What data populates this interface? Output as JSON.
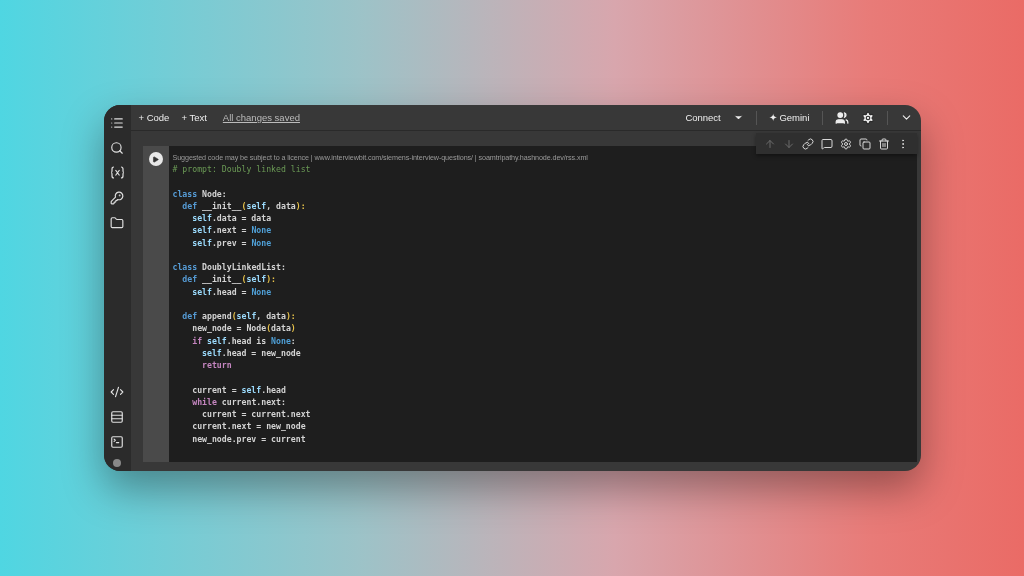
{
  "toolbar": {
    "actions": [
      "+ Code",
      "+ Text"
    ],
    "save_status": "All changes saved",
    "connect": "Connect",
    "gemini": "✦ Gemini"
  },
  "cell": {
    "notice": "Suggested code may be subject to a licence | www.interviewbit.com/siemens-interview-questions/ | soamtripathy.hashnode.dev/rss.xml",
    "cell_tools": [
      {
        "disabled": true
      },
      {
        "disabled": true
      },
      {
        "disabled": false
      },
      {
        "disabled": false
      },
      {
        "disabled": false
      },
      {
        "disabled": false
      },
      {
        "disabled": false
      },
      {
        "disabled": false
      }
    ],
    "lines": [
      {
        "kind": "code",
        "tokens": [
          {
            "t": "# prompt: Doubly linked list",
            "kind": "comment"
          }
        ]
      },
      {
        "kind": "blank"
      },
      {
        "kind": "code",
        "tokens": [
          {
            "t": "class",
            "kind": "keyword"
          },
          {
            "t": " Node:",
            "kind": "plain"
          }
        ]
      },
      {
        "kind": "code",
        "tokens": [
          {
            "t": "  def",
            "kind": "keyword"
          },
          {
            "t": " __init__",
            "kind": "plain"
          },
          {
            "t": "(",
            "kind": "paren"
          },
          {
            "t": "self",
            "kind": "self"
          },
          {
            "t": ", data",
            "kind": "plain"
          },
          {
            "t": "):",
            "kind": "paren"
          }
        ]
      },
      {
        "kind": "code",
        "tokens": [
          {
            "t": "    self",
            "kind": "self"
          },
          {
            "t": ".data = data",
            "kind": "plain"
          }
        ]
      },
      {
        "kind": "code",
        "tokens": [
          {
            "t": "    self",
            "kind": "self"
          },
          {
            "t": ".next = ",
            "kind": "plain"
          },
          {
            "t": "None",
            "kind": "const"
          }
        ]
      },
      {
        "kind": "code",
        "tokens": [
          {
            "t": "    self",
            "kind": "self"
          },
          {
            "t": ".prev = ",
            "kind": "plain"
          },
          {
            "t": "None",
            "kind": "const"
          }
        ]
      },
      {
        "kind": "blank"
      },
      {
        "kind": "code",
        "tokens": [
          {
            "t": "class",
            "kind": "keyword"
          },
          {
            "t": " DoublyLinkedList:",
            "kind": "plain"
          }
        ]
      },
      {
        "kind": "code",
        "tokens": [
          {
            "t": "  def",
            "kind": "keyword"
          },
          {
            "t": " __init__",
            "kind": "plain"
          },
          {
            "t": "(",
            "kind": "paren"
          },
          {
            "t": "self",
            "kind": "self"
          },
          {
            "t": "):",
            "kind": "paren"
          }
        ]
      },
      {
        "kind": "code",
        "tokens": [
          {
            "t": "    self",
            "kind": "self"
          },
          {
            "t": ".head = ",
            "kind": "plain"
          },
          {
            "t": "None",
            "kind": "const"
          }
        ]
      },
      {
        "kind": "blank"
      },
      {
        "kind": "code",
        "tokens": [
          {
            "t": "  def",
            "kind": "keyword"
          },
          {
            "t": " append",
            "kind": "plain"
          },
          {
            "t": "(",
            "kind": "paren"
          },
          {
            "t": "self",
            "kind": "self"
          },
          {
            "t": ", data",
            "kind": "plain"
          },
          {
            "t": "):",
            "kind": "paren"
          }
        ]
      },
      {
        "kind": "code",
        "tokens": [
          {
            "t": "    new_node = Node",
            "kind": "plain"
          },
          {
            "t": "(",
            "kind": "paren"
          },
          {
            "t": "data",
            "kind": "plain"
          },
          {
            "t": ")",
            "kind": "paren"
          }
        ]
      },
      {
        "kind": "code",
        "tokens": [
          {
            "t": "    if",
            "kind": "control"
          },
          {
            "t": " self",
            "kind": "self"
          },
          {
            "t": ".head ",
            "kind": "plain"
          },
          {
            "t": "is",
            "kind": "plain"
          },
          {
            "t": " None",
            "kind": "const"
          },
          {
            "t": ":",
            "kind": "plain"
          }
        ]
      },
      {
        "kind": "code",
        "tokens": [
          {
            "t": "      self",
            "kind": "self"
          },
          {
            "t": ".head = new_node",
            "kind": "plain"
          }
        ]
      },
      {
        "kind": "code",
        "tokens": [
          {
            "t": "      return",
            "kind": "control"
          }
        ]
      },
      {
        "kind": "blank"
      },
      {
        "kind": "code",
        "tokens": [
          {
            "t": "    current = ",
            "kind": "plain"
          },
          {
            "t": "self",
            "kind": "self"
          },
          {
            "t": ".head",
            "kind": "plain"
          }
        ]
      },
      {
        "kind": "code",
        "tokens": [
          {
            "t": "    while",
            "kind": "control"
          },
          {
            "t": " current.next:",
            "kind": "plain"
          }
        ]
      },
      {
        "kind": "code",
        "tokens": [
          {
            "t": "      current = current.next",
            "kind": "plain"
          }
        ]
      },
      {
        "kind": "code",
        "tokens": [
          {
            "t": "    current.next = new_node",
            "kind": "plain"
          }
        ]
      },
      {
        "kind": "code",
        "tokens": [
          {
            "t": "    new_node.prev = current",
            "kind": "plain"
          }
        ]
      }
    ]
  }
}
